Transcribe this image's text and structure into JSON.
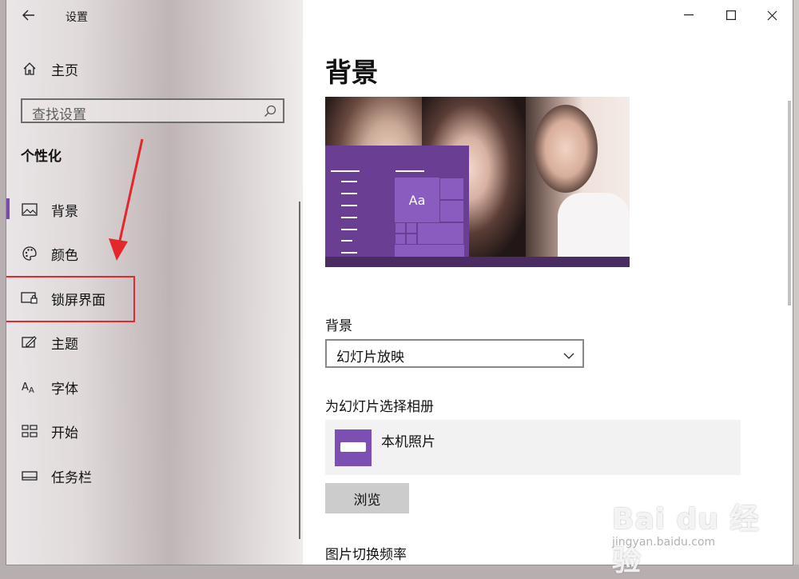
{
  "app": {
    "title": "设置",
    "back_icon": "back-arrow-icon"
  },
  "sidebar": {
    "home_label": "主页",
    "search_placeholder": "查找设置",
    "section_title": "个性化",
    "items": [
      {
        "label": "背景",
        "icon": "picture-icon",
        "selected": true
      },
      {
        "label": "颜色",
        "icon": "palette-icon",
        "selected": false
      },
      {
        "label": "锁屏界面",
        "icon": "lock-screen-icon",
        "selected": false
      },
      {
        "label": "主题",
        "icon": "theme-icon",
        "selected": false
      },
      {
        "label": "字体",
        "icon": "font-icon",
        "selected": false
      },
      {
        "label": "开始",
        "icon": "start-icon",
        "selected": false
      },
      {
        "label": "任务栏",
        "icon": "taskbar-icon",
        "selected": false
      }
    ],
    "accent_color": "#7a4aa8"
  },
  "main": {
    "page_title": "背景",
    "preview": {
      "tile_label": "Aa"
    },
    "background_label": "背景",
    "background_value": "幻灯片放映",
    "album_label": "为幻灯片选择相册",
    "album_name": "本机照片",
    "browse_label": "浏览",
    "interval_label": "图片切换频率"
  },
  "annotation": {
    "box_color": "#e4272c"
  },
  "watermark": {
    "main": "Bai du 经验",
    "sub": "jingyan.baidu.com"
  }
}
